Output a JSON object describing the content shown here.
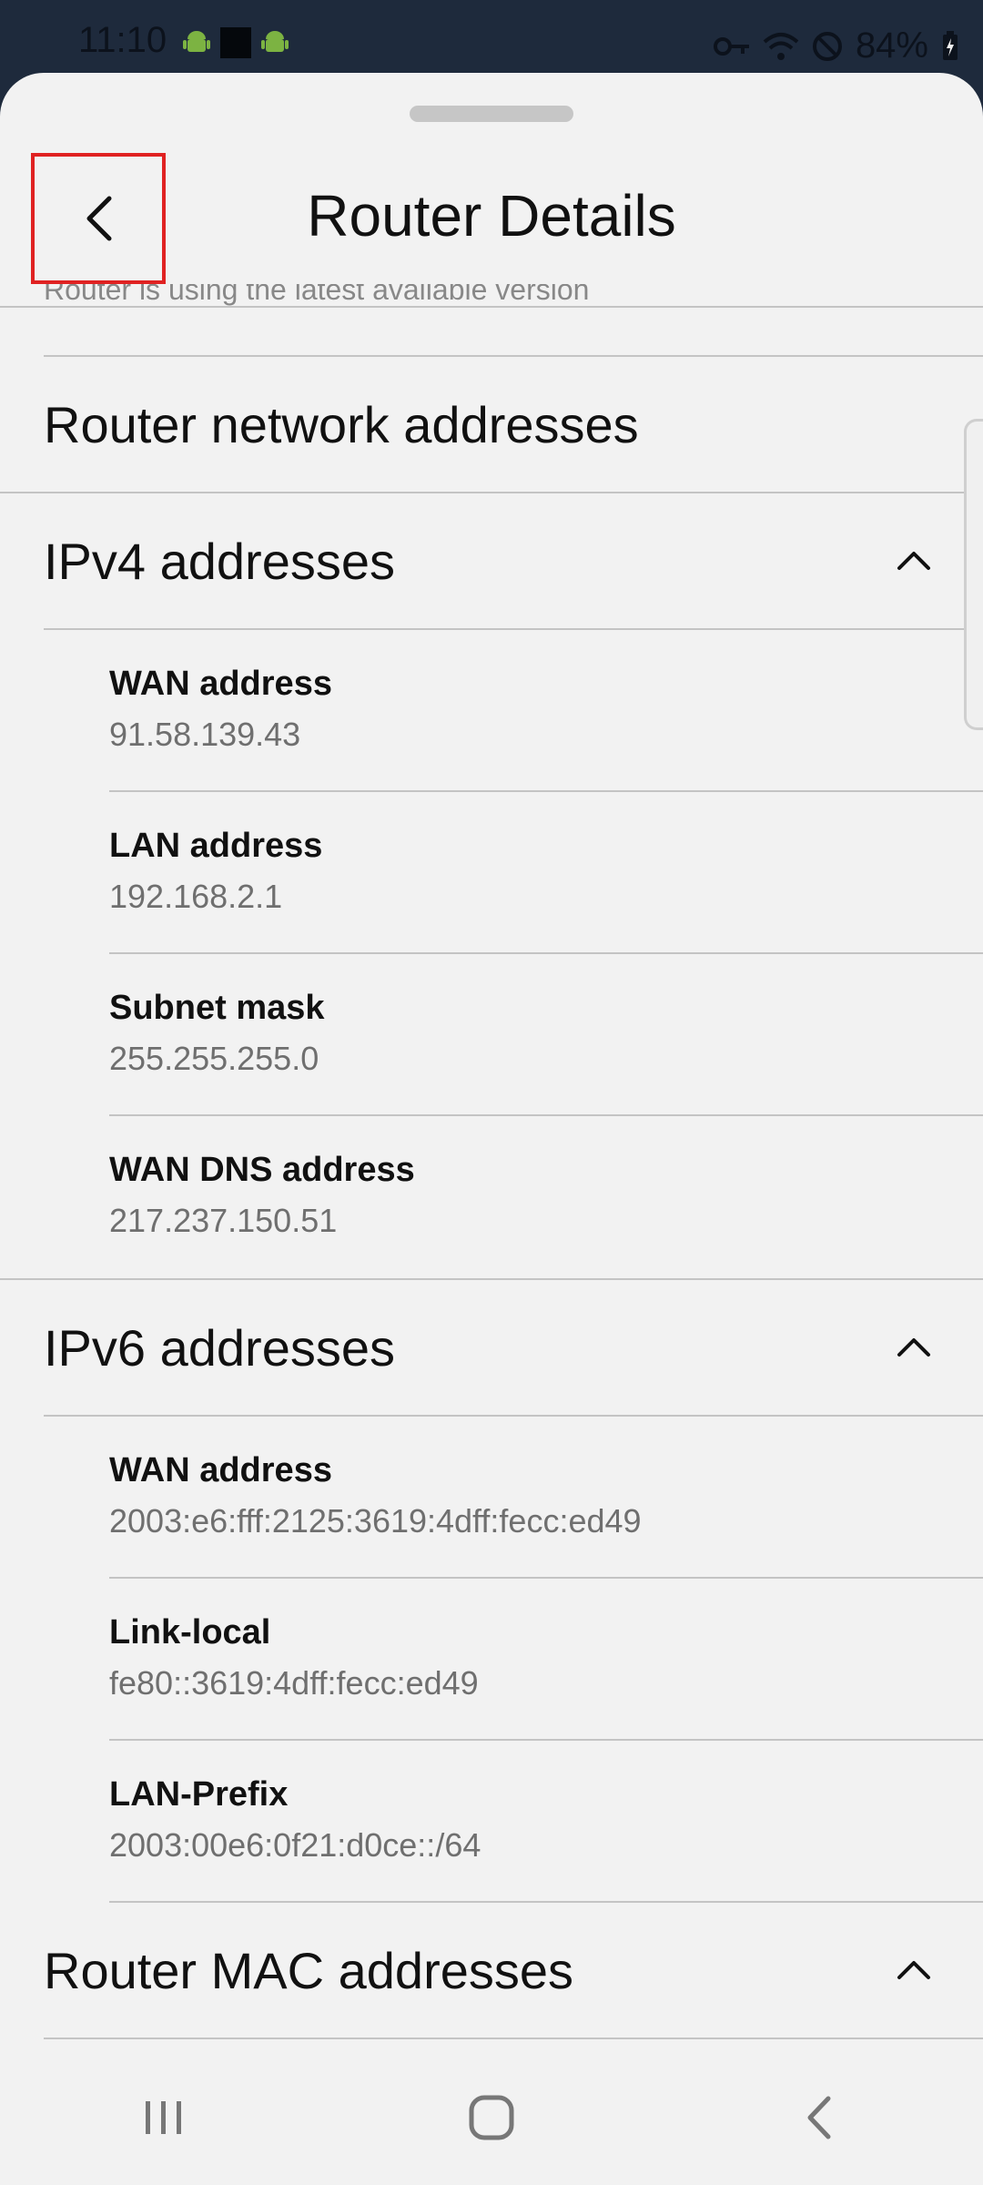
{
  "status_bar": {
    "time": "11:10",
    "battery": "84%",
    "icons": [
      "android-icon",
      "square-icon",
      "android-icon",
      "key-icon",
      "wifi-icon",
      "blocked-icon",
      "battery-charging-icon"
    ]
  },
  "header": {
    "title": "Router Details",
    "back_icon": "chevron-left-icon",
    "cut_off_text": "Router is using the latest available version"
  },
  "sections": [
    {
      "title": "Router network addresses"
    },
    {
      "title": "IPv4 addresses",
      "expanded": true,
      "items": [
        {
          "label": "WAN address",
          "value": "91.58.139.43"
        },
        {
          "label": "LAN address",
          "value": "192.168.2.1"
        },
        {
          "label": "Subnet mask",
          "value": "255.255.255.0"
        },
        {
          "label": "WAN DNS address",
          "value": "217.237.150.51"
        }
      ]
    },
    {
      "title": "IPv6 addresses",
      "expanded": true,
      "items": [
        {
          "label": "WAN address",
          "value": "2003:e6:fff:2125:3619:4dff:fecc:ed49"
        },
        {
          "label": "Link-local",
          "value": "fe80::3619:4dff:fecc:ed49"
        },
        {
          "label": "LAN-Prefix",
          "value": "2003:00e6:0f21:d0ce::/64"
        }
      ]
    },
    {
      "title": "Router MAC addresses",
      "expanded": true
    }
  ],
  "colors": {
    "status_bar_bg": "#1e2a3c",
    "sheet_bg": "#f2f2f2",
    "divider": "#c4c4c4",
    "secondary_text": "#6f6f6f",
    "highlight_box": "#e02222"
  }
}
